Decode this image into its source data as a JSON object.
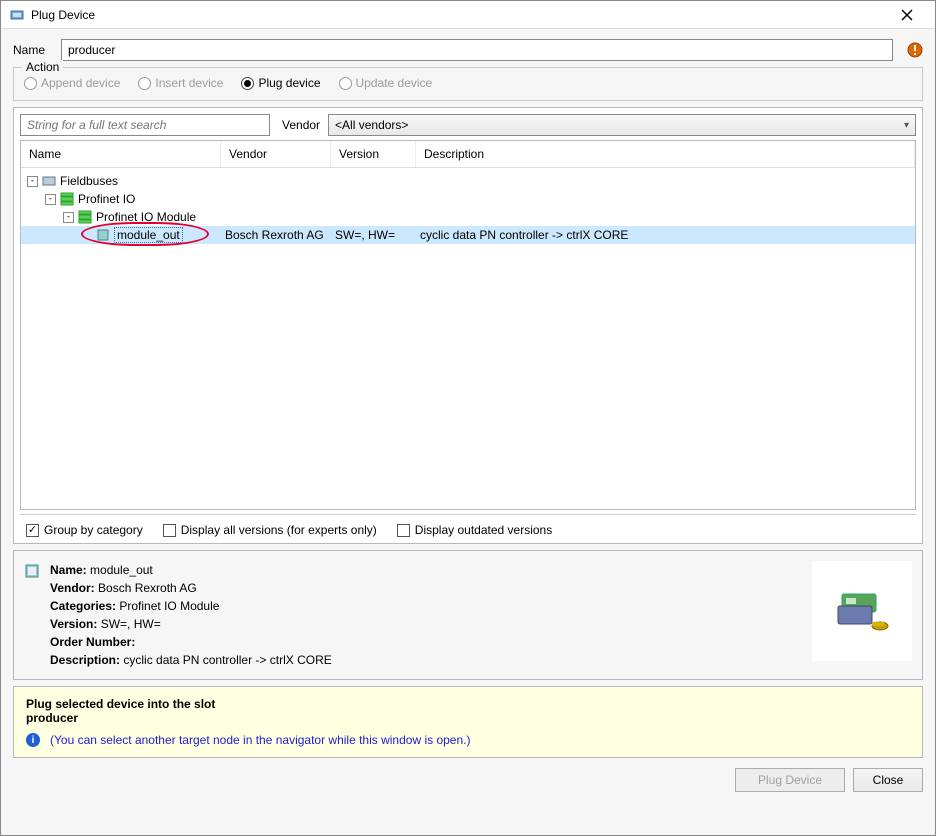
{
  "window": {
    "title": "Plug Device"
  },
  "name_field": {
    "label": "Name",
    "value": "producer"
  },
  "action": {
    "legend": "Action",
    "options": [
      {
        "label": "Append device",
        "selected": false,
        "enabled": false
      },
      {
        "label": "Insert device",
        "selected": false,
        "enabled": false
      },
      {
        "label": "Plug device",
        "selected": true,
        "enabled": true
      },
      {
        "label": "Update device",
        "selected": false,
        "enabled": false
      }
    ]
  },
  "search": {
    "placeholder": "String for a full text search"
  },
  "vendor_filter": {
    "label": "Vendor",
    "value": "<All vendors>"
  },
  "grid": {
    "columns": {
      "name": "Name",
      "vendor": "Vendor",
      "version": "Version",
      "description": "Description"
    },
    "tree": [
      {
        "level": 0,
        "expanded": true,
        "icon": "folder",
        "name": "Fieldbuses",
        "vendor": "",
        "version": "",
        "desc": "",
        "selected": false
      },
      {
        "level": 1,
        "expanded": true,
        "icon": "profinet",
        "name": "Profinet IO",
        "vendor": "",
        "version": "",
        "desc": "",
        "selected": false
      },
      {
        "level": 2,
        "expanded": true,
        "icon": "profinet",
        "name": "Profinet IO Module",
        "vendor": "",
        "version": "",
        "desc": "",
        "selected": false
      },
      {
        "level": 3,
        "expanded": false,
        "icon": "module",
        "name": "module_out",
        "vendor": "Bosch Rexroth AG",
        "version": "SW=, HW=",
        "desc": "cyclic data PN controller -> ctrlX CORE",
        "selected": true
      }
    ]
  },
  "checks": {
    "group_by_category": {
      "label": "Group by category",
      "checked": true
    },
    "display_all_versions": {
      "label": "Display all versions (for experts only)",
      "checked": false
    },
    "display_outdated": {
      "label": "Display outdated versions",
      "checked": false
    }
  },
  "details": {
    "name_label": "Name:",
    "name": "module_out",
    "vendor_label": "Vendor:",
    "vendor": "Bosch Rexroth AG",
    "categories_label": "Categories:",
    "categories": "Profinet IO Module",
    "version_label": "Version:",
    "version": "SW=, HW=",
    "order_label": "Order Number:",
    "order": "",
    "desc_label": "Description:",
    "desc": "cyclic data PN controller -> ctrlX CORE"
  },
  "hint": {
    "line1": "Plug selected device into the slot",
    "line2": "producer",
    "info": "(You can select another target node in the navigator while this window is open.)"
  },
  "buttons": {
    "plug": "Plug Device",
    "close": "Close"
  }
}
